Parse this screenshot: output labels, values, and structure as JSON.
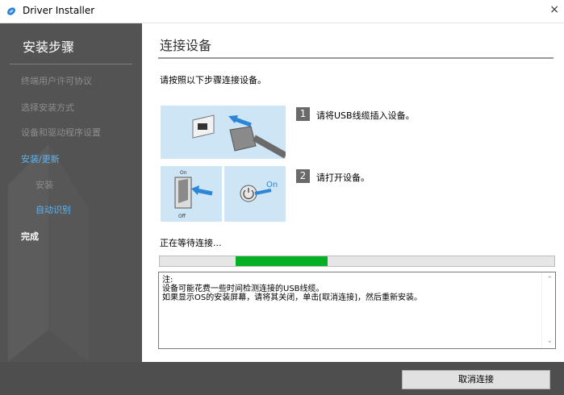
{
  "window": {
    "title": "Driver Installer",
    "close_symbol": "×",
    "app_icon": "driver-installer-icon"
  },
  "sidebar": {
    "heading": "安装步骤",
    "steps": [
      {
        "label": "终端用户许可协议",
        "state": "done"
      },
      {
        "label": "选择安装方式",
        "state": "done"
      },
      {
        "label": "设备和驱动程序设置",
        "state": "done"
      },
      {
        "label": "安装/更新",
        "state": "active"
      },
      {
        "label": "安装",
        "state": "sub-done"
      },
      {
        "label": "自动识别",
        "state": "sub-active"
      },
      {
        "label": "完成",
        "state": "pending"
      }
    ]
  },
  "main": {
    "title": "连接设备",
    "intro": "请按照以下步骤连接设备。",
    "steps": [
      {
        "number": "1",
        "text": "请将USB线缆插入设备。",
        "image": "usb-plug-illustration"
      },
      {
        "number": "2",
        "text": "请打开设备。",
        "image": "power-switch-illustration"
      }
    ],
    "power_label_on": "On",
    "switch_on": "On",
    "switch_off": "Off",
    "waiting_text": "正在等待连接...",
    "progress_percent": 42,
    "note": "注:\n设备可能花费一些时间检测连接的USB线缆。\n如果显示OS的安装屏幕，请将其关闭，单击[取消连接]，然后重新安装。"
  },
  "footer": {
    "cancel_label": "取消连接"
  },
  "colors": {
    "sidebar_bg": "#535353",
    "active_step": "#5fb4f2",
    "progress_fill": "#06b025",
    "footer_bg": "#4e4e4e",
    "illustration_bg": "#cde5f5"
  }
}
